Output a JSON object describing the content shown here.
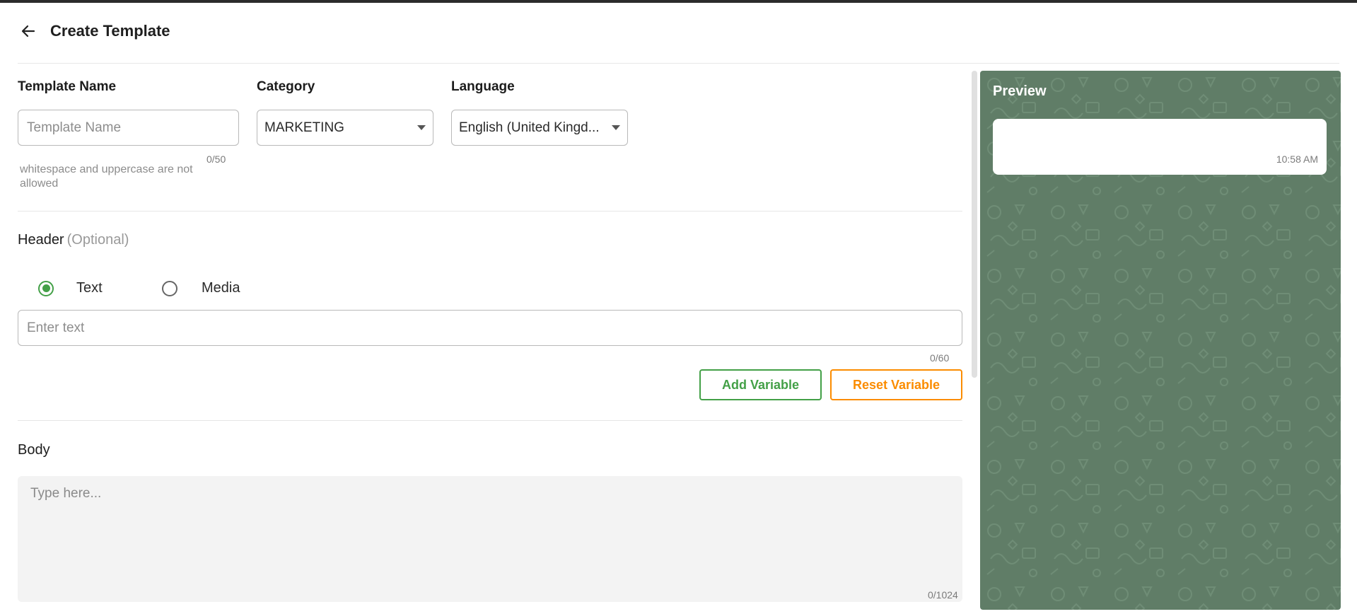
{
  "page": {
    "title": "Create Template",
    "back_icon": "arrow-left-icon"
  },
  "template_name": {
    "label": "Template Name",
    "placeholder": "Template Name",
    "value": "",
    "counter": "0/50",
    "helper": "whitespace and uppercase are not allowed"
  },
  "category": {
    "label": "Category",
    "selected": "MARKETING"
  },
  "language": {
    "label": "Language",
    "selected": "English (United Kingd..."
  },
  "header": {
    "title": "Header",
    "optional": "(Optional)",
    "options": [
      {
        "label": "Text",
        "checked": true
      },
      {
        "label": "Media",
        "checked": false
      }
    ],
    "input_placeholder": "Enter text",
    "counter": "0/60",
    "add_variable": "Add Variable",
    "reset_variable": "Reset Variable"
  },
  "body": {
    "title": "Body",
    "placeholder": "Type here...",
    "counter": "0/1024"
  },
  "preview": {
    "title": "Preview",
    "time": "10:58 AM"
  },
  "colors": {
    "accent_green": "#43a047",
    "accent_orange": "#fb8c00",
    "preview_bg": "#607d67"
  }
}
